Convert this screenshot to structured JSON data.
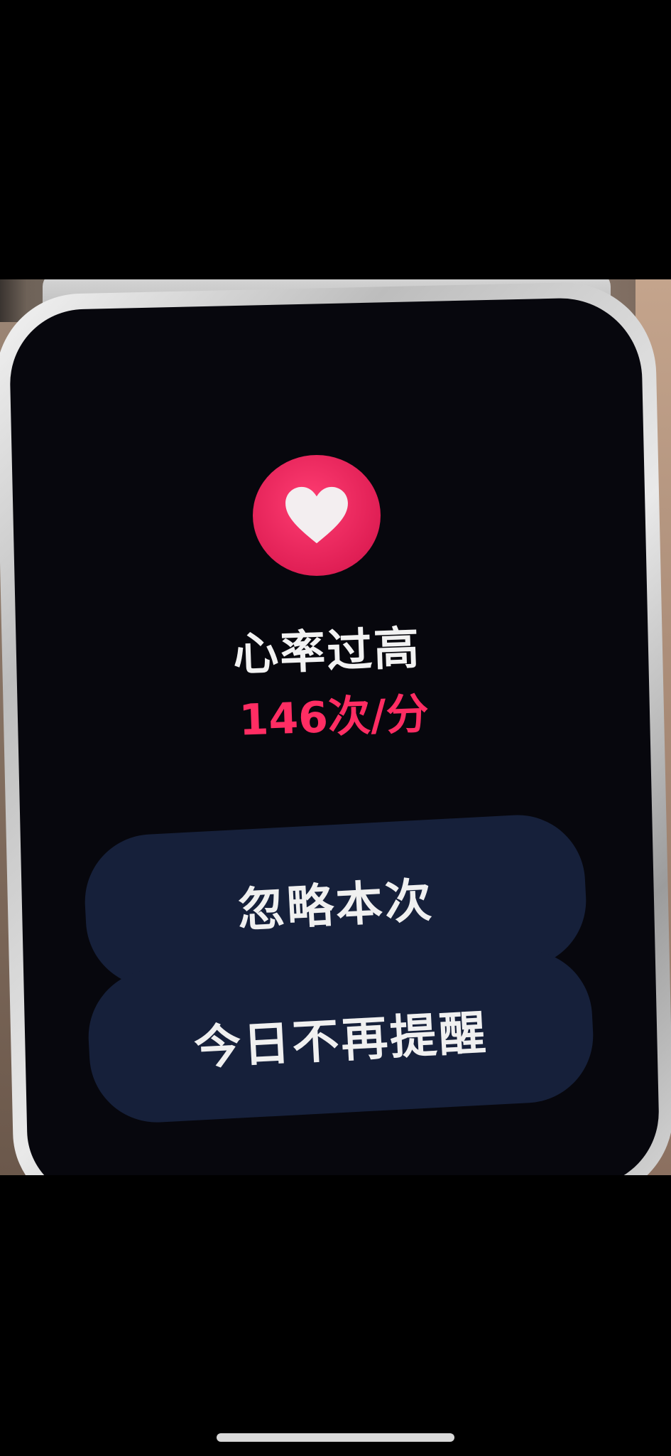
{
  "alert": {
    "icon": "heart-icon",
    "title": "心率过高",
    "rate": "146次/分",
    "accent_color": "#ff2d63",
    "icon_bg_color": "#e8265c"
  },
  "actions": {
    "ignore_label": "忽略本次",
    "mute_today_label": "今日不再提醒"
  }
}
